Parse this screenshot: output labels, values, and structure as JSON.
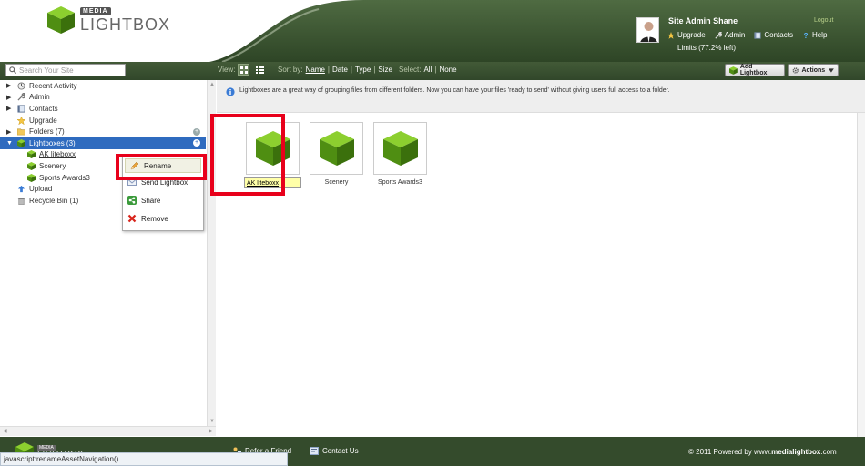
{
  "brand": {
    "media": "MEDIA",
    "name": "LIGHTBOX"
  },
  "user": {
    "name": "Site Admin Shane",
    "logout": "Logout",
    "links": [
      "Upgrade",
      "Admin",
      "Contacts",
      "Help"
    ],
    "limits": "Limits (77.2% left)"
  },
  "toolbar": {
    "search_placeholder": "Search Your Site",
    "view_label": "View:",
    "sort_label": "Sort by:",
    "sort_options": [
      "Name",
      "Date",
      "Type",
      "Size"
    ],
    "select_label": "Select:",
    "select_options": [
      "All",
      "None"
    ],
    "add_lightbox": "Add Lightbox",
    "actions": "Actions"
  },
  "sidebar": {
    "items": [
      {
        "label": "Recent Activity"
      },
      {
        "label": "Admin"
      },
      {
        "label": "Contacts"
      },
      {
        "label": "Upgrade"
      },
      {
        "label": "Folders (7)"
      },
      {
        "label": "Lightboxes (3)"
      },
      {
        "label": "AK liteboxx"
      },
      {
        "label": "Scenery"
      },
      {
        "label": "Sports Awards3"
      },
      {
        "label": "Upload"
      },
      {
        "label": "Recycle Bin (1)"
      }
    ]
  },
  "context_menu": {
    "items": [
      "Rename",
      "Send Lightbox",
      "Share",
      "Remove"
    ]
  },
  "main": {
    "info": "Lightboxes are a great way of grouping files from different folders. Now you can have your files 'ready to send' without giving users full access to a folder.",
    "rename_value": "AK liteboxx",
    "lightboxes": [
      "Scenery",
      "Sports Awards3"
    ]
  },
  "footer": {
    "refer": "Refer a Friend",
    "contact": "Contact Us",
    "copyright_prefix": "© 2011 Powered by www.",
    "copyright_bold": "medialightbox",
    "copyright_suffix": ".com",
    "status": "javascript:renameAssetNavigation()"
  },
  "colors": {
    "header_green": "#3d5a33",
    "accent_green": "#5b9a1c",
    "selected_blue": "#2f6bbf",
    "highlight_red": "#e8001b"
  }
}
